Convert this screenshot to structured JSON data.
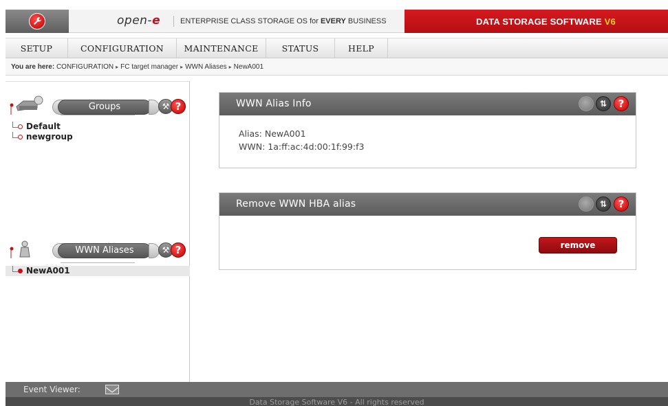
{
  "header": {
    "brand_prefix": "open-",
    "brand_suffix": "e",
    "tagline_prefix": "ENTERPRISE CLASS STORAGE OS for ",
    "tagline_bold": "EVERY",
    "tagline_suffix": " BUSINESS",
    "product_title": "DATA STORAGE SOFTWARE ",
    "product_version": "V6",
    "accent_color": "#c4121a"
  },
  "menu": {
    "items": [
      {
        "label": "SETUP"
      },
      {
        "label": "CONFIGURATION"
      },
      {
        "label": "MAINTENANCE"
      },
      {
        "label": "STATUS"
      },
      {
        "label": "HELP"
      }
    ]
  },
  "breadcrumb": {
    "prefix": "You are here:",
    "items": [
      "CONFIGURATION",
      "FC target manager",
      "WWN Aliases",
      "NewA001"
    ],
    "separator": "▸"
  },
  "sidebar": {
    "groups": {
      "title": "Groups",
      "items": [
        "Default",
        "newgroup"
      ]
    },
    "aliases": {
      "title": "WWN Aliases",
      "items": [
        "NewA001"
      ]
    }
  },
  "info_panel": {
    "title": "WWN Alias Info",
    "alias_label": "Alias: NewA001",
    "wwn_label": "WWN: 1a:ff:ac:4d:00:1f:99:f3"
  },
  "remove_panel": {
    "title": "Remove WWN HBA alias",
    "button_label": "remove"
  },
  "event_viewer": {
    "label": "Event Viewer:"
  },
  "footer": {
    "text": "Data Storage Software V6 - All rights reserved"
  },
  "icons": {
    "logo": "wrench-logo-icon",
    "groups": "groups-icon",
    "alias": "person-icon",
    "settings": "wrench-icon",
    "help": "help-icon",
    "spinner": "loading-icon",
    "refresh": "refresh-icon",
    "mail": "envelope-icon"
  }
}
